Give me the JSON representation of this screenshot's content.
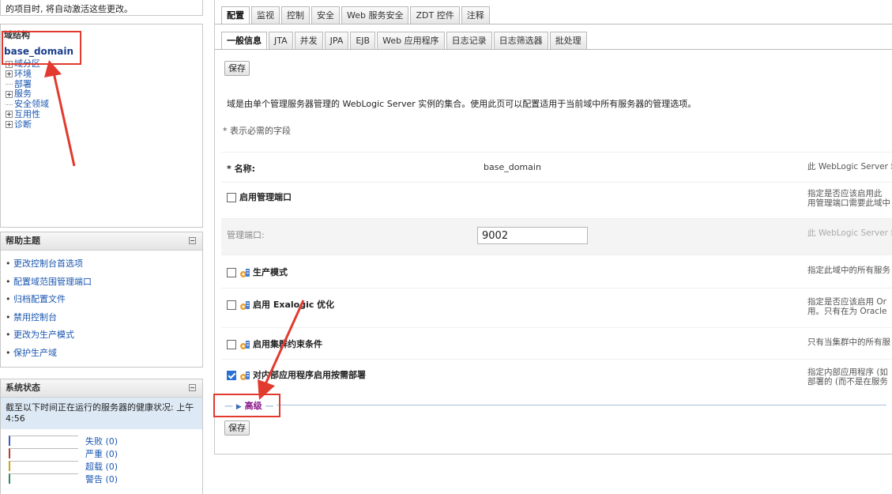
{
  "top_notice": "的项目时, 将自动激活这些更改。",
  "domain_structure": {
    "title": "域结构",
    "root": "base_domain",
    "items": [
      {
        "label": "域分区",
        "expandable": true
      },
      {
        "label": "环境",
        "expandable": true
      },
      {
        "label": "部署",
        "expandable": false
      },
      {
        "label": "服务",
        "expandable": true
      },
      {
        "label": "安全领域",
        "expandable": false
      },
      {
        "label": "互用性",
        "expandable": true
      },
      {
        "label": "诊断",
        "expandable": true
      }
    ]
  },
  "help_topics": {
    "title": "帮助主题",
    "items": [
      "更改控制台首选项",
      "配置域范围管理端口",
      "归档配置文件",
      "禁用控制台",
      "更改为生产模式",
      "保护生产域"
    ]
  },
  "system_status": {
    "title": "系统状态",
    "description": "截至以下时间正在运行的服务器的健康状况: 上午4:56",
    "rows": [
      {
        "label": "失败 (0)",
        "color": "#3a5bbf"
      },
      {
        "label": "严重 (0)",
        "color": "#c0392b"
      },
      {
        "label": "超载 (0)",
        "color": "#d4a017"
      },
      {
        "label": "警告 (0)",
        "color": "#2e8b57"
      }
    ]
  },
  "main_tabs": [
    "配置",
    "监视",
    "控制",
    "安全",
    "Web 服务安全",
    "ZDT 控件",
    "注释"
  ],
  "sub_tabs": [
    "一般信息",
    "JTA",
    "并发",
    "JPA",
    "EJB",
    "Web 应用程序",
    "日志记录",
    "日志筛选器",
    "批处理"
  ],
  "save_label": "保存",
  "description": "域是由单个管理服务器管理的 WebLogic Server 实例的集合。使用此页可以配置适用于当前域中所有服务器的管理选项。",
  "required_note": "* 表示必需的字段",
  "fields": {
    "name": {
      "label": "* 名称:",
      "value": "base_domain",
      "help": "此 WebLogic Server 域"
    },
    "admin_port_enabled": {
      "label": "启用管理端口",
      "checked": false,
      "help": "指定是否应该启用此\n用管理端口需要此域中"
    },
    "admin_port": {
      "label": "管理端口:",
      "value": "9002",
      "help": "此 WebLogic Server 域"
    },
    "production_mode": {
      "label": "生产模式",
      "checked": false,
      "help": "指定此域中的所有服务"
    },
    "exalogic": {
      "label": "启用 Exalogic 优化",
      "checked": false,
      "help": "指定是否应该启用 Or\n用。只有在为 Oracle"
    },
    "cluster_constraints": {
      "label": "启用集群约束条件",
      "checked": false,
      "help": "只有当集群中的所有服"
    },
    "on_demand_deploy": {
      "label": "对内部应用程序启用按需部署",
      "checked": true,
      "help": "指定内部应用程序 (如\n部署的 (而不是在服务"
    }
  },
  "advanced_label": "高级",
  "colors": {
    "annotation": "#e23a2e",
    "link": "#1a56b0",
    "advanced": "#8b1a8b"
  }
}
